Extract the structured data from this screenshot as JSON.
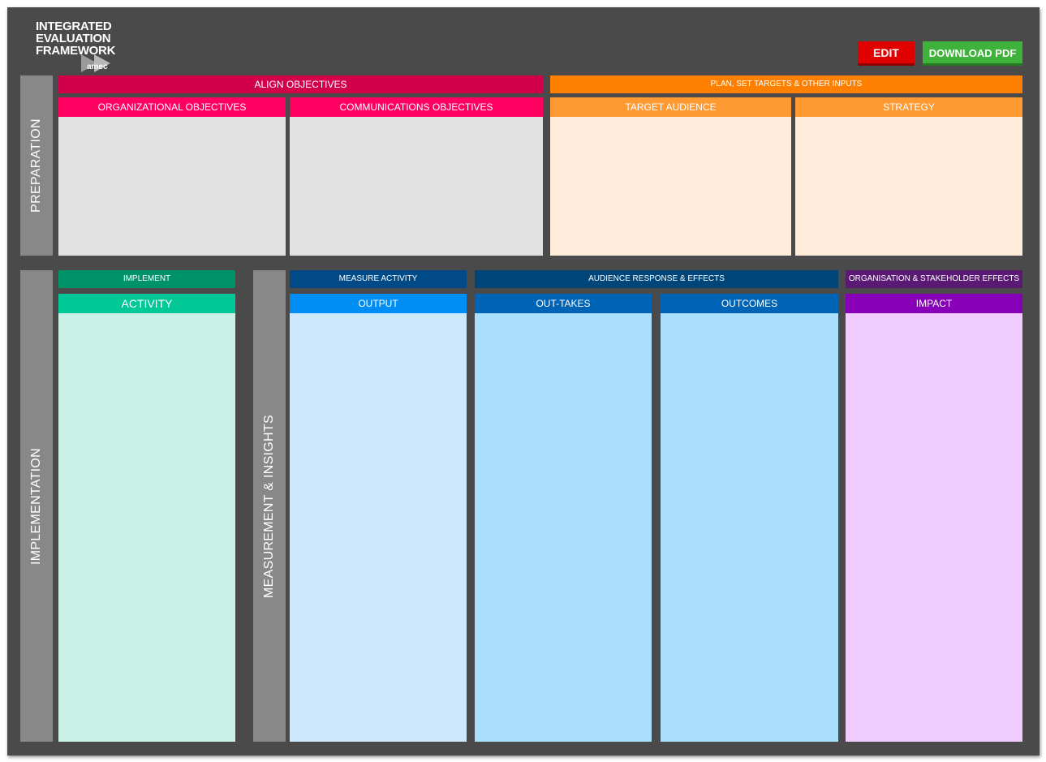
{
  "logo": {
    "line1": "INTEGRATED",
    "line2": "EVALUATION",
    "line3": "FRAMEWORK",
    "brand": "amec"
  },
  "toolbar": {
    "edit_label": "EDIT",
    "download_label": "DOWNLOAD PDF"
  },
  "preparation": {
    "side_label": "PREPARATION",
    "align_objectives": {
      "title": "ALIGN OBJECTIVES",
      "organizational": "ORGANIZATIONAL OBJECTIVES",
      "communications": "COMMUNICATIONS OBJECTIVES"
    },
    "plan": {
      "title": "PLAN, SET TARGETS & OTHER INPUTS",
      "target_audience": "TARGET AUDIENCE",
      "strategy": "STRATEGY"
    }
  },
  "implementation": {
    "side_label": "IMPLEMENTATION",
    "group_title": "IMPLEMENT",
    "activity": "ACTIVITY"
  },
  "measurement": {
    "side_label": "MEASUREMENT & INSIGHTS",
    "measure_activity": {
      "title": "MEASURE ACTIVITY",
      "output": "OUTPUT"
    },
    "audience_response": {
      "title": "AUDIENCE RESPONSE & EFFECTS",
      "out_takes": "OUT-TAKES",
      "outcomes": "OUTCOMES"
    },
    "organisation_effects": {
      "title": "ORGANISATION & STAKEHOLDER EFFECTS",
      "impact": "IMPACT"
    }
  },
  "colors": {
    "background": "#4a4a4a",
    "side_bar": "#888888",
    "align_title": "#d2004a",
    "align_sub": "#ff0060",
    "align_area": "#e1e1e1",
    "plan_title": "#ff8000",
    "plan_sub": "#ff9a33",
    "plan_area": "#ffecda",
    "implement_title": "#00936a",
    "activity_sub": "#00c896",
    "activity_area": "#c9f1e6",
    "measure_title": "#004b87",
    "output_sub": "#008ef5",
    "output_area": "#cde8fd",
    "audience_title": "#004577",
    "audience_sub": "#0064b6",
    "audience_area": "#a9dffc",
    "org_title": "#5a1a73",
    "impact_sub": "#8700b8",
    "impact_area": "#f0cbfd",
    "edit_button": "#e00000",
    "download_button": "#3eb23a"
  }
}
